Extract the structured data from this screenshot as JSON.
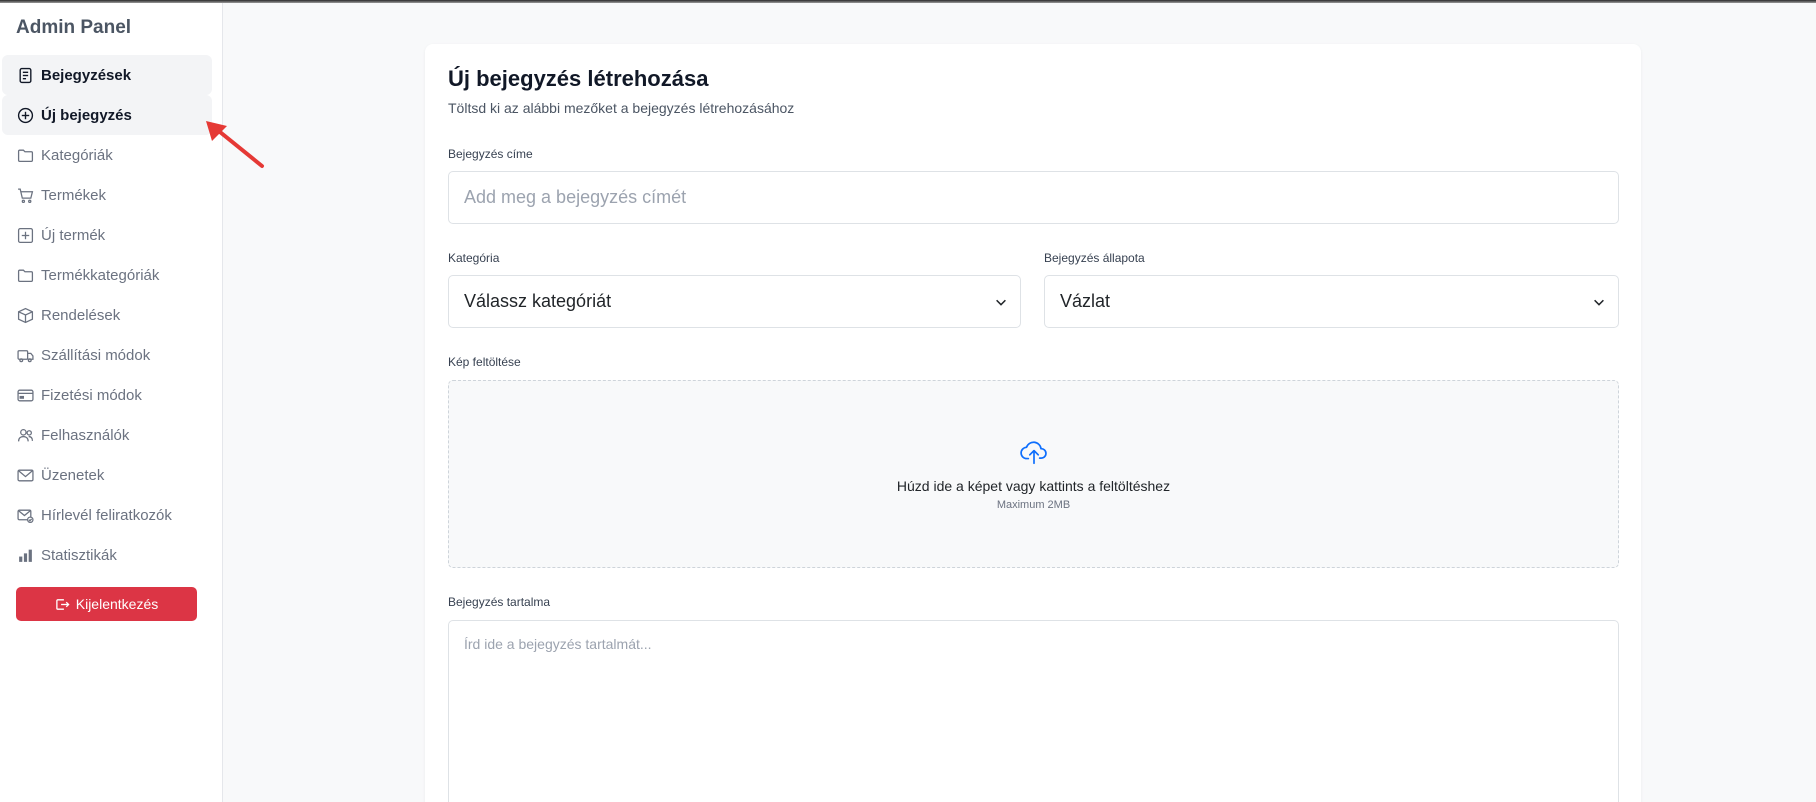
{
  "sidebar": {
    "brand": "Admin Panel",
    "items": [
      {
        "label": "Bejegyzések",
        "icon": "document-icon"
      },
      {
        "label": "Új bejegyzés",
        "icon": "plus-circle-icon"
      },
      {
        "label": "Kategóriák",
        "icon": "folder-icon"
      },
      {
        "label": "Termékek",
        "icon": "cart-icon"
      },
      {
        "label": "Új termék",
        "icon": "plus-square-icon"
      },
      {
        "label": "Termékkategóriák",
        "icon": "folder-icon"
      },
      {
        "label": "Rendelések",
        "icon": "box-icon"
      },
      {
        "label": "Szállítási módok",
        "icon": "truck-icon"
      },
      {
        "label": "Fizetési módok",
        "icon": "credit-card-icon"
      },
      {
        "label": "Felhasználók",
        "icon": "users-icon"
      },
      {
        "label": "Üzenetek",
        "icon": "envelope-icon"
      },
      {
        "label": "Hírlevél feliratkozók",
        "icon": "envelope-check-icon"
      },
      {
        "label": "Statisztikák",
        "icon": "bar-chart-icon"
      }
    ],
    "logout_label": "Kijelentkezés"
  },
  "form": {
    "title": "Új bejegyzés létrehozása",
    "subtitle": "Töltsd ki az alábbi mezőket a bejegyzés létrehozásához",
    "title_label": "Bejegyzés címe",
    "title_placeholder": "Add meg a bejegyzés címét",
    "category_label": "Kategória",
    "category_value": "Válassz kategóriát",
    "status_label": "Bejegyzés állapota",
    "status_value": "Vázlat",
    "image_label": "Kép feltöltése",
    "dropzone_text": "Húzd ide a képet vagy kattints a feltöltéshez",
    "dropzone_sub": "Maximum 2MB",
    "content_label": "Bejegyzés tartalma",
    "content_placeholder": "Írd ide a bejegyzés tartalmát..."
  },
  "colors": {
    "danger": "#dc3545",
    "upload_icon": "#0d6efd",
    "annotation_arrow": "#e53935"
  }
}
